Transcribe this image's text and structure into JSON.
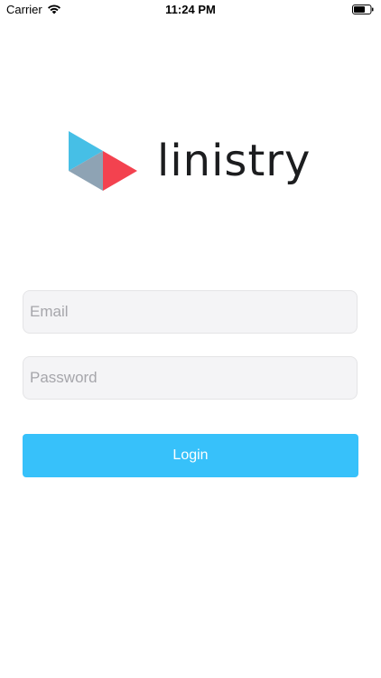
{
  "status_bar": {
    "carrier": "Carrier",
    "time": "11:24 PM",
    "wifi_icon": "wifi-icon",
    "battery_icon": "battery-icon"
  },
  "logo": {
    "wordmark": "linistry",
    "mark_icon": "linistry-logo-mark",
    "colors": {
      "blue": "#46bfe6",
      "gray": "#8ea3b4",
      "red": "#f3424f"
    }
  },
  "form": {
    "email": {
      "placeholder": "Email",
      "value": ""
    },
    "password": {
      "placeholder": "Password",
      "value": ""
    },
    "login_label": "Login"
  },
  "colors": {
    "accent": "#37c1fa",
    "field_background": "#f4f4f6"
  }
}
